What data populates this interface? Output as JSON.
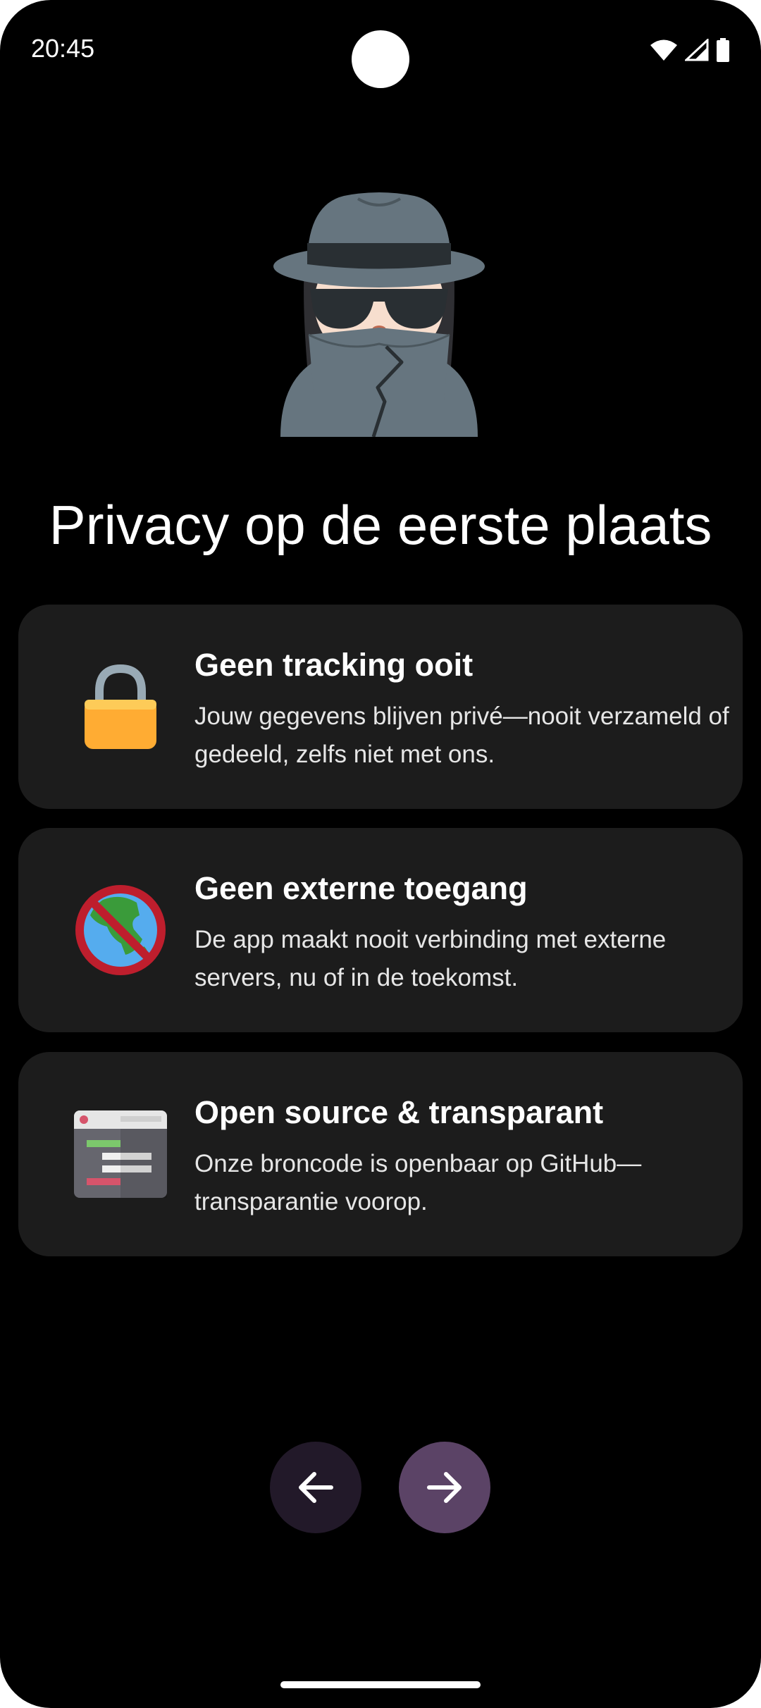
{
  "status_bar": {
    "time": "20:45",
    "icons": [
      "wifi-icon",
      "cellular-signal-icon",
      "battery-icon"
    ]
  },
  "hero": {
    "icon": "detective-spy-emoji"
  },
  "title": "Privacy op de eerste plaats",
  "cards": [
    {
      "icon": "lock-icon",
      "title": "Geen tracking ooit",
      "description": "Jouw gegevens blijven privé—nooit verzameld of gedeeld, zelfs niet met ons."
    },
    {
      "icon": "no-globe-icon",
      "title": "Geen externe toegang",
      "description": "De app maakt nooit verbinding met externe servers, nu of in de toekomst."
    },
    {
      "icon": "code-window-icon",
      "title": "Open source & transparant",
      "description": "Onze broncode is openbaar op GitHub—transparantie voorop."
    }
  ],
  "navigation": {
    "back_icon": "arrow-left-icon",
    "next_icon": "arrow-right-icon"
  },
  "colors": {
    "background": "#000000",
    "card": "#1c1c1c",
    "back_button": "#221929",
    "next_button": "#5b4366",
    "lock_gold": "#fbb040",
    "prohibit_red": "#be1e2d"
  }
}
